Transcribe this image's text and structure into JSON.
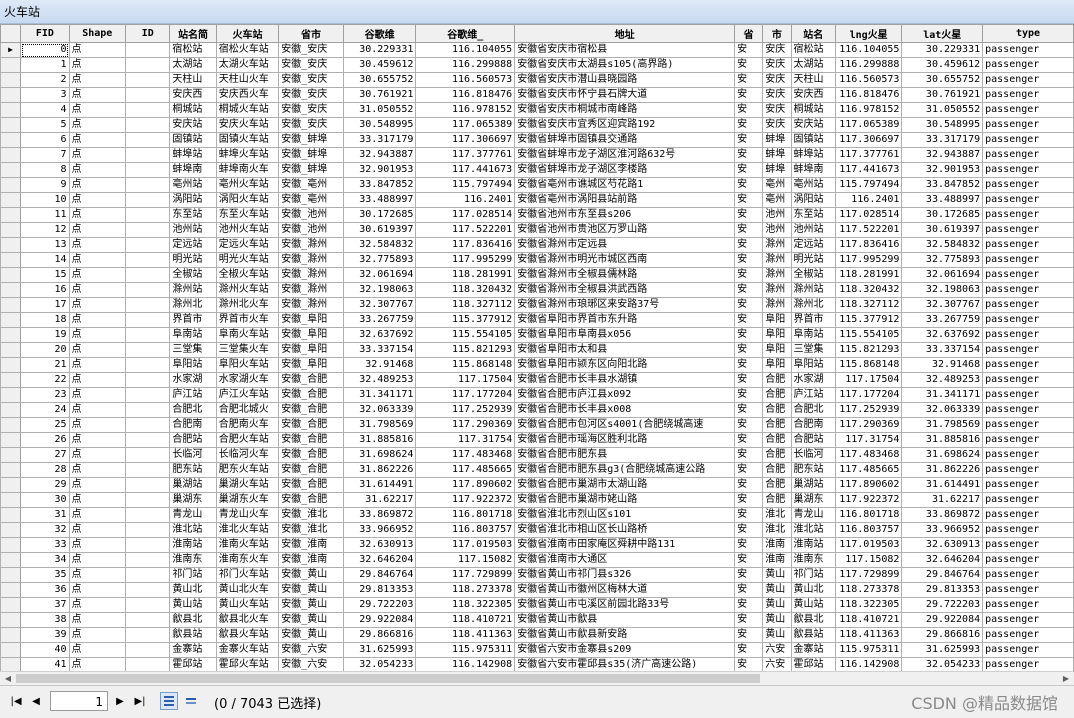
{
  "window": {
    "title": "火车站"
  },
  "columns": [
    "FID",
    "Shape",
    "ID",
    "站名简",
    "火车站",
    "省市",
    "谷歌维",
    "谷歌维_",
    "地址",
    "省",
    "市",
    "站名",
    "lng火星",
    "lat火星",
    "type"
  ],
  "rows": [
    [
      "0",
      "点",
      "",
      "宿松站",
      "宿松火车站",
      "安徽_安庆",
      "30.229331",
      "116.104055",
      "安徽省安庆市宿松县",
      "安",
      "安庆",
      "宿松站",
      "116.104055",
      "30.229331",
      "passenger"
    ],
    [
      "1",
      "点",
      "",
      "太湖站",
      "太湖火车站",
      "安徽_安庆",
      "30.459612",
      "116.299888",
      "安徽省安庆市太湖县s105(高界路)",
      "安",
      "安庆",
      "太湖站",
      "116.299888",
      "30.459612",
      "passenger"
    ],
    [
      "2",
      "点",
      "",
      "天柱山",
      "天柱山火车",
      "安徽_安庆",
      "30.655752",
      "116.560573",
      "安徽省安庆市潜山县晓园路",
      "安",
      "安庆",
      "天柱山",
      "116.560573",
      "30.655752",
      "passenger"
    ],
    [
      "3",
      "点",
      "",
      "安庆西",
      "安庆西火车",
      "安徽_安庆",
      "30.761921",
      "116.818476",
      "安徽省安庆市怀宁县石牌大道",
      "安",
      "安庆",
      "安庆西",
      "116.818476",
      "30.761921",
      "passenger"
    ],
    [
      "4",
      "点",
      "",
      "桐城站",
      "桐城火车站",
      "安徽_安庆",
      "31.050552",
      "116.978152",
      "安徽省安庆市桐城市南峰路",
      "安",
      "安庆",
      "桐城站",
      "116.978152",
      "31.050552",
      "passenger"
    ],
    [
      "5",
      "点",
      "",
      "安庆站",
      "安庆火车站",
      "安徽_安庆",
      "30.548995",
      "117.065389",
      "安徽省安庆市宜秀区迎宾路192",
      "安",
      "安庆",
      "安庆站",
      "117.065389",
      "30.548995",
      "passenger"
    ],
    [
      "6",
      "点",
      "",
      "固镇站",
      "固镇火车站",
      "安徽_蚌埠",
      "33.317179",
      "117.306697",
      "安徽省蚌埠市固镇县交通路",
      "安",
      "蚌埠",
      "固镇站",
      "117.306697",
      "33.317179",
      "passenger"
    ],
    [
      "7",
      "点",
      "",
      "蚌埠站",
      "蚌埠火车站",
      "安徽_蚌埠",
      "32.943887",
      "117.377761",
      "安徽省蚌埠市龙子湖区淮河路632号",
      "安",
      "蚌埠",
      "蚌埠站",
      "117.377761",
      "32.943887",
      "passenger"
    ],
    [
      "8",
      "点",
      "",
      "蚌埠南",
      "蚌埠南火车",
      "安徽_蚌埠",
      "32.901953",
      "117.441673",
      "安徽省蚌埠市龙子湖区李楼路",
      "安",
      "蚌埠",
      "蚌埠南",
      "117.441673",
      "32.901953",
      "passenger"
    ],
    [
      "9",
      "点",
      "",
      "亳州站",
      "亳州火车站",
      "安徽_亳州",
      "33.847852",
      "115.797494",
      "安徽省亳州市谯城区芍花路1",
      "安",
      "亳州",
      "亳州站",
      "115.797494",
      "33.847852",
      "passenger"
    ],
    [
      "10",
      "点",
      "",
      "涡阳站",
      "涡阳火车站",
      "安徽_亳州",
      "33.488997",
      "116.2401",
      "安徽省亳州市涡阳县站前路",
      "安",
      "亳州",
      "涡阳站",
      "116.2401",
      "33.488997",
      "passenger"
    ],
    [
      "11",
      "点",
      "",
      "东至站",
      "东至火车站",
      "安徽_池州",
      "30.172685",
      "117.028514",
      "安徽省池州市东至县s206",
      "安",
      "池州",
      "东至站",
      "117.028514",
      "30.172685",
      "passenger"
    ],
    [
      "12",
      "点",
      "",
      "池州站",
      "池州火车站",
      "安徽_池州",
      "30.619397",
      "117.522201",
      "安徽省池州市贵池区万罗山路",
      "安",
      "池州",
      "池州站",
      "117.522201",
      "30.619397",
      "passenger"
    ],
    [
      "13",
      "点",
      "",
      "定远站",
      "定远火车站",
      "安徽_滁州",
      "32.584832",
      "117.836416",
      "安徽省滁州市定远县",
      "安",
      "滁州",
      "定远站",
      "117.836416",
      "32.584832",
      "passenger"
    ],
    [
      "14",
      "点",
      "",
      "明光站",
      "明光火车站",
      "安徽_滁州",
      "32.775893",
      "117.995299",
      "安徽省滁州市明光市城区西南",
      "安",
      "滁州",
      "明光站",
      "117.995299",
      "32.775893",
      "passenger"
    ],
    [
      "15",
      "点",
      "",
      "全椒站",
      "全椒火车站",
      "安徽_滁州",
      "32.061694",
      "118.281991",
      "安徽省滁州市全椒县儒林路",
      "安",
      "滁州",
      "全椒站",
      "118.281991",
      "32.061694",
      "passenger"
    ],
    [
      "16",
      "点",
      "",
      "滁州站",
      "滁州火车站",
      "安徽_滁州",
      "32.198063",
      "118.320432",
      "安徽省滁州市全椒县洪武西路",
      "安",
      "滁州",
      "滁州站",
      "118.320432",
      "32.198063",
      "passenger"
    ],
    [
      "17",
      "点",
      "",
      "滁州北",
      "滁州北火车",
      "安徽_滁州",
      "32.307767",
      "118.327112",
      "安徽省滁州市琅琊区来安路37号",
      "安",
      "滁州",
      "滁州北",
      "118.327112",
      "32.307767",
      "passenger"
    ],
    [
      "18",
      "点",
      "",
      "界首市",
      "界首市火车",
      "安徽_阜阳",
      "33.267759",
      "115.377912",
      "安徽省阜阳市界首市东升路",
      "安",
      "阜阳",
      "界首市",
      "115.377912",
      "33.267759",
      "passenger"
    ],
    [
      "19",
      "点",
      "",
      "阜南站",
      "阜南火车站",
      "安徽_阜阳",
      "32.637692",
      "115.554105",
      "安徽省阜阳市阜南县x056",
      "安",
      "阜阳",
      "阜南站",
      "115.554105",
      "32.637692",
      "passenger"
    ],
    [
      "20",
      "点",
      "",
      "三堂集",
      "三堂集火车",
      "安徽_阜阳",
      "33.337154",
      "115.821293",
      "安徽省阜阳市太和县",
      "安",
      "阜阳",
      "三堂集",
      "115.821293",
      "33.337154",
      "passenger"
    ],
    [
      "21",
      "点",
      "",
      "阜阳站",
      "阜阳火车站",
      "安徽_阜阳",
      "32.91468",
      "115.868148",
      "安徽省阜阳市颍东区向阳北路",
      "安",
      "阜阳",
      "阜阳站",
      "115.868148",
      "32.91468",
      "passenger"
    ],
    [
      "22",
      "点",
      "",
      "水家湖",
      "水家湖火车",
      "安徽_合肥",
      "32.489253",
      "117.17504",
      "安徽省合肥市长丰县水湖镇",
      "安",
      "合肥",
      "水家湖",
      "117.17504",
      "32.489253",
      "passenger"
    ],
    [
      "23",
      "点",
      "",
      "庐江站",
      "庐江火车站",
      "安徽_合肥",
      "31.341171",
      "117.177204",
      "安徽省合肥市庐江县x092",
      "安",
      "合肥",
      "庐江站",
      "117.177204",
      "31.341171",
      "passenger"
    ],
    [
      "24",
      "点",
      "",
      "合肥北",
      "合肥北城火",
      "安徽_合肥",
      "32.063339",
      "117.252939",
      "安徽省合肥市长丰县x008",
      "安",
      "合肥",
      "合肥北",
      "117.252939",
      "32.063339",
      "passenger"
    ],
    [
      "25",
      "点",
      "",
      "合肥南",
      "合肥南火车",
      "安徽_合肥",
      "31.798569",
      "117.290369",
      "安徽省合肥市包河区s4001(合肥绕城高速",
      "安",
      "合肥",
      "合肥南",
      "117.290369",
      "31.798569",
      "passenger"
    ],
    [
      "26",
      "点",
      "",
      "合肥站",
      "合肥火车站",
      "安徽_合肥",
      "31.885816",
      "117.31754",
      "安徽省合肥市瑶海区胜利北路",
      "安",
      "合肥",
      "合肥站",
      "117.31754",
      "31.885816",
      "passenger"
    ],
    [
      "27",
      "点",
      "",
      "长临河",
      "长临河火车",
      "安徽_合肥",
      "31.698624",
      "117.483468",
      "安徽省合肥市肥东县",
      "安",
      "合肥",
      "长临河",
      "117.483468",
      "31.698624",
      "passenger"
    ],
    [
      "28",
      "点",
      "",
      "肥东站",
      "肥东火车站",
      "安徽_合肥",
      "31.862226",
      "117.485665",
      "安徽省合肥市肥东县g3(合肥绕城高速公路",
      "安",
      "合肥",
      "肥东站",
      "117.485665",
      "31.862226",
      "passenger"
    ],
    [
      "29",
      "点",
      "",
      "巢湖站",
      "巢湖火车站",
      "安徽_合肥",
      "31.614491",
      "117.890602",
      "安徽省合肥市巢湖市太湖山路",
      "安",
      "合肥",
      "巢湖站",
      "117.890602",
      "31.614491",
      "passenger"
    ],
    [
      "30",
      "点",
      "",
      "巢湖东",
      "巢湖东火车",
      "安徽_合肥",
      "31.62217",
      "117.922372",
      "安徽省合肥市巢湖市姥山路",
      "安",
      "合肥",
      "巢湖东",
      "117.922372",
      "31.62217",
      "passenger"
    ],
    [
      "31",
      "点",
      "",
      "青龙山",
      "青龙山火车",
      "安徽_淮北",
      "33.869872",
      "116.801718",
      "安徽省淮北市烈山区s101",
      "安",
      "淮北",
      "青龙山",
      "116.801718",
      "33.869872",
      "passenger"
    ],
    [
      "32",
      "点",
      "",
      "淮北站",
      "淮北火车站",
      "安徽_淮北",
      "33.966952",
      "116.803757",
      "安徽省淮北市相山区长山路桥",
      "安",
      "淮北",
      "淮北站",
      "116.803757",
      "33.966952",
      "passenger"
    ],
    [
      "33",
      "点",
      "",
      "淮南站",
      "淮南火车站",
      "安徽_淮南",
      "32.630913",
      "117.019503",
      "安徽省淮南市田家庵区舜耕中路131",
      "安",
      "淮南",
      "淮南站",
      "117.019503",
      "32.630913",
      "passenger"
    ],
    [
      "34",
      "点",
      "",
      "淮南东",
      "淮南东火车",
      "安徽_淮南",
      "32.646204",
      "117.15082",
      "安徽省淮南市大通区",
      "安",
      "淮南",
      "淮南东",
      "117.15082",
      "32.646204",
      "passenger"
    ],
    [
      "35",
      "点",
      "",
      "祁门站",
      "祁门火车站",
      "安徽_黄山",
      "29.846764",
      "117.729899",
      "安徽省黄山市祁门县s326",
      "安",
      "黄山",
      "祁门站",
      "117.729899",
      "29.846764",
      "passenger"
    ],
    [
      "36",
      "点",
      "",
      "黄山北",
      "黄山北火车",
      "安徽_黄山",
      "29.813353",
      "118.273378",
      "安徽省黄山市徽州区梅林大道",
      "安",
      "黄山",
      "黄山北",
      "118.273378",
      "29.813353",
      "passenger"
    ],
    [
      "37",
      "点",
      "",
      "黄山站",
      "黄山火车站",
      "安徽_黄山",
      "29.722203",
      "118.322305",
      "安徽省黄山市屯溪区前园北路33号",
      "安",
      "黄山",
      "黄山站",
      "118.322305",
      "29.722203",
      "passenger"
    ],
    [
      "38",
      "点",
      "",
      "歙县北",
      "歙县北火车",
      "安徽_黄山",
      "29.922084",
      "118.410721",
      "安徽省黄山市歙县",
      "安",
      "黄山",
      "歙县北",
      "118.410721",
      "29.922084",
      "passenger"
    ],
    [
      "39",
      "点",
      "",
      "歙县站",
      "歙县火车站",
      "安徽_黄山",
      "29.866816",
      "118.411363",
      "安徽省黄山市歙县新安路",
      "安",
      "黄山",
      "歙县站",
      "118.411363",
      "29.866816",
      "passenger"
    ],
    [
      "40",
      "点",
      "",
      "金寨站",
      "金寨火车站",
      "安徽_六安",
      "31.625993",
      "115.975311",
      "安徽省六安市金寨县s209",
      "安",
      "六安",
      "金寨站",
      "115.975311",
      "31.625993",
      "passenger"
    ],
    [
      "41",
      "点",
      "",
      "霍邱站",
      "霍邱火车站",
      "安徽_六安",
      "32.054233",
      "116.142908",
      "安徽省六安市霍邱县s35(济广高速公路)",
      "安",
      "六安",
      "霍邱站",
      "116.142908",
      "32.054233",
      "passenger"
    ]
  ],
  "current_row": 0,
  "record_nav": {
    "current": "1",
    "status": "(0 / 7043 已选择)"
  },
  "watermark": "CSDN @精品数据馆"
}
